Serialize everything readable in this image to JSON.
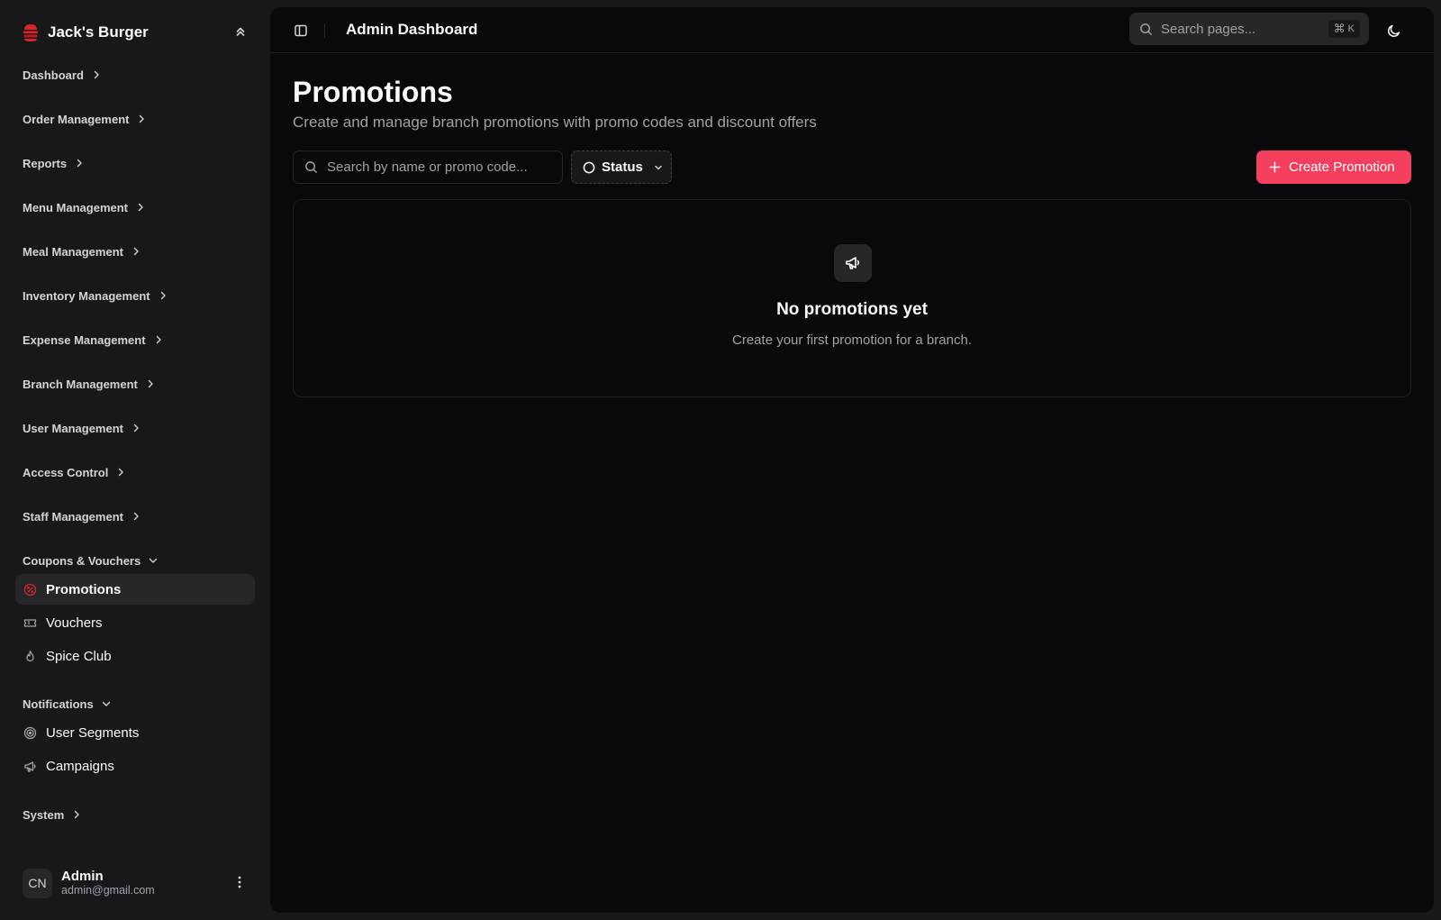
{
  "brand": {
    "name": "Jack's Burger",
    "accent": "#dc2626"
  },
  "sidebar": {
    "groups": [
      {
        "label": "Dashboard",
        "expanded": false
      },
      {
        "label": "Order Management",
        "expanded": false
      },
      {
        "label": "Reports",
        "expanded": false
      },
      {
        "label": "Menu Management",
        "expanded": false
      },
      {
        "label": "Meal Management",
        "expanded": false
      },
      {
        "label": "Inventory Management",
        "expanded": false
      },
      {
        "label": "Expense Management",
        "expanded": false
      },
      {
        "label": "Branch Management",
        "expanded": false
      },
      {
        "label": "User Management",
        "expanded": false
      },
      {
        "label": "Access Control",
        "expanded": false
      },
      {
        "label": "Staff Management",
        "expanded": false
      },
      {
        "label": "Coupons & Vouchers",
        "expanded": true
      },
      {
        "label": "Notifications",
        "expanded": true
      },
      {
        "label": "System",
        "expanded": false
      }
    ],
    "coupons_items": [
      {
        "label": "Promotions",
        "icon": "badge-percent-icon",
        "active": true
      },
      {
        "label": "Vouchers",
        "icon": "ticket-icon",
        "active": false
      },
      {
        "label": "Spice Club",
        "icon": "flame-icon",
        "active": false
      }
    ],
    "notifications_items": [
      {
        "label": "User Segments",
        "icon": "target-icon",
        "active": false
      },
      {
        "label": "Campaigns",
        "icon": "megaphone-icon",
        "active": false
      }
    ],
    "user": {
      "initials": "CN",
      "name": "Admin",
      "email": "admin@gmail.com"
    }
  },
  "topbar": {
    "title": "Admin Dashboard",
    "search_placeholder": "Search pages...",
    "shortcut": "K"
  },
  "page": {
    "title": "Promotions",
    "subtitle": "Create and manage branch promotions with promo codes and discount offers",
    "search_placeholder": "Search by name or promo code...",
    "status_filter_label": "Status",
    "create_button_label": "Create Promotion",
    "create_button_color": "#f43f5e"
  },
  "empty_state": {
    "icon": "megaphone-icon",
    "title": "No promotions yet",
    "description": "Create your first promotion for a branch."
  }
}
